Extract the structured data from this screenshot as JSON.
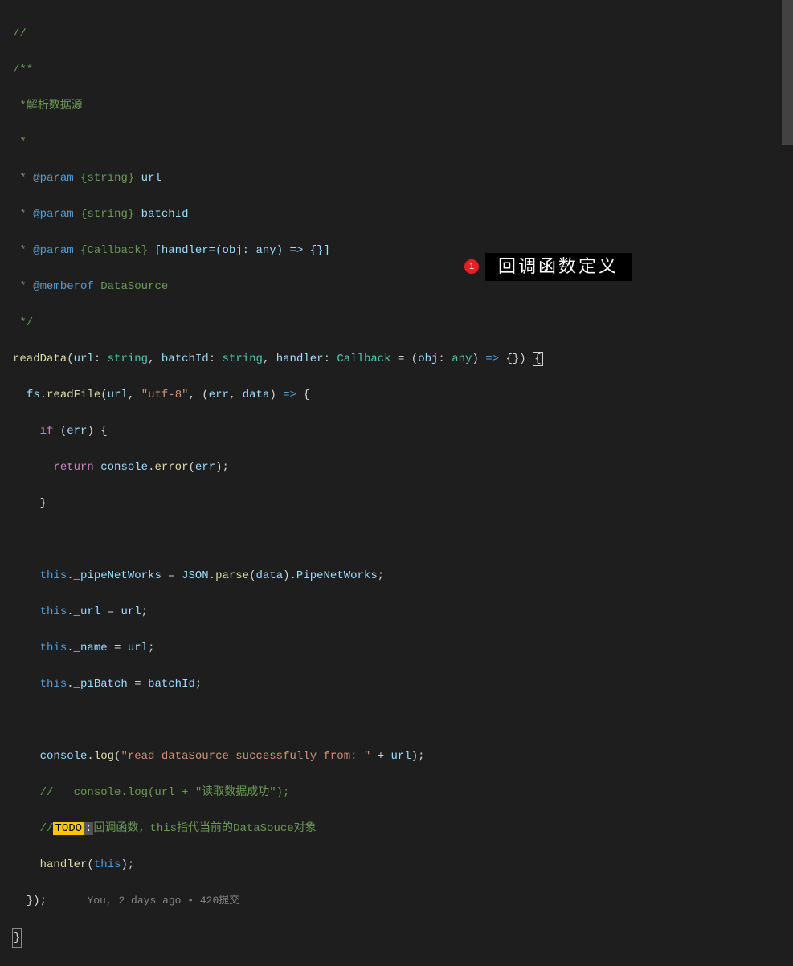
{
  "code": {
    "l1": "//",
    "l2": "/**",
    "l3_1": " *",
    "l3_2": "解析数据源",
    "l4": " *",
    "l5_1": " * ",
    "l5_tag": "@param",
    "l5_type": " {string}",
    "l5_name": " url",
    "l6_tag": "@param",
    "l6_type": " {string}",
    "l6_name": " batchId",
    "l7_tag": "@param",
    "l7_type": " {Callback}",
    "l7_name": " [handler=(obj: any) => {}]",
    "l8_tag": "@memberof",
    "l8_name": " DataSource",
    "l9": " */",
    "fn_name": "readData",
    "p1_name": "url",
    "p1_type": "string",
    "p2_name": "batchId",
    "p2_type": "string",
    "p3_name": "handler",
    "p3_type": "Callback",
    "p3_dname": "obj",
    "p3_dtype": "any",
    "fs": "fs",
    "readFile": "readFile",
    "utf8": "\"utf-8\"",
    "err": "err",
    "data": "data",
    "if_kw": "if",
    "return_kw": "return",
    "console": "console",
    "error": "error",
    "log": "log",
    "this_kw": "this",
    "pipeNetWorks": "_pipeNetWorks",
    "JSON": "JSON",
    "parse": "parse",
    "PipeNetWorks": "PipeNetWorks",
    "url_prop": "_url",
    "name_prop": "_name",
    "piBatch_prop": "_piBatch",
    "log_str": "\"read dataSource successfully from: \"",
    "comment_log": "//   console.log(url + \"读取数据成功\");",
    "comment_prefix": "//",
    "todo": "TODO",
    "colon": ":",
    "todo_text": "回调函数，this指代当前的DataSouce对象",
    "handler_call": "handler",
    "code_lens": "You, 2 days ago • 420提交"
  },
  "annotation": {
    "badge": "1",
    "text": "回调函数定义"
  }
}
